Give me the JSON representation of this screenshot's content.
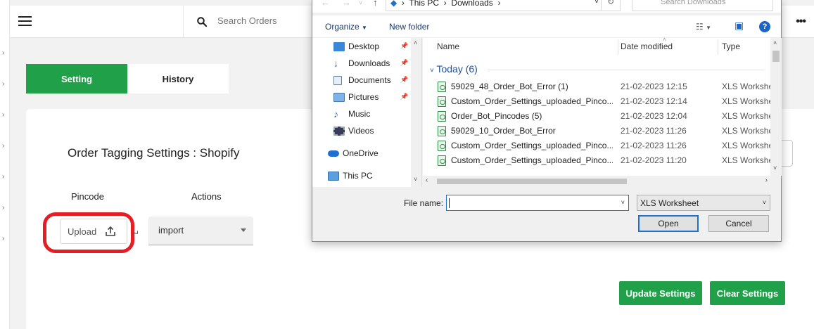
{
  "header": {
    "search_placeholder": "Search Orders"
  },
  "tabs": [
    {
      "label": "Setting",
      "active": true
    },
    {
      "label": "History",
      "active": false
    }
  ],
  "card": {
    "title": "Order Tagging Settings : Shopify",
    "col_pincode": "Pincode",
    "col_actions": "Actions",
    "upload_label": "Upload",
    "action_value": "import",
    "update_button": "Update Settings",
    "clear_button": "Clear Settings"
  },
  "colors": {
    "accent_green": "#21a04a",
    "highlight_red": "#e31e25",
    "dialog_blue": "#1e6fd0"
  },
  "dialog": {
    "breadcrumb": [
      "This PC",
      "Downloads"
    ],
    "search_placeholder": "Search Downloads",
    "organize_label": "Organize",
    "new_folder_label": "New folder",
    "nav_items": [
      {
        "label": "Desktop",
        "icon": "desktop-icon",
        "pinned": true
      },
      {
        "label": "Downloads",
        "icon": "download-arrow-icon",
        "pinned": true
      },
      {
        "label": "Documents",
        "icon": "document-icon",
        "pinned": true
      },
      {
        "label": "Pictures",
        "icon": "picture-icon",
        "pinned": true
      },
      {
        "label": "Music",
        "icon": "music-note-icon",
        "pinned": false
      },
      {
        "label": "Videos",
        "icon": "video-icon",
        "pinned": false
      },
      {
        "label": "OneDrive",
        "icon": "cloud-icon",
        "pinned": false
      },
      {
        "label": "This PC",
        "icon": "computer-icon",
        "pinned": false
      }
    ],
    "columns": {
      "name": "Name",
      "date": "Date modified",
      "type": "Type"
    },
    "group_label": "Today (6)",
    "files": [
      {
        "name": "59029_48_Order_Bot_Error (1)",
        "date": "21-02-2023 12:15",
        "type": "XLS Worksheet"
      },
      {
        "name": "Custom_Order_Settings_uploaded_Pinco...",
        "date": "21-02-2023 12:14",
        "type": "XLS Worksheet"
      },
      {
        "name": "Order_Bot_Pincodes (5)",
        "date": "21-02-2023 12:04",
        "type": "XLS Worksheet"
      },
      {
        "name": "59029_10_Order_Bot_Error",
        "date": "21-02-2023 11:26",
        "type": "XLS Worksheet"
      },
      {
        "name": "Custom_Order_Settings_uploaded_Pinco...",
        "date": "21-02-2023 11:26",
        "type": "XLS Worksheet"
      },
      {
        "name": "Custom_Order_Settings_uploaded_Pinco...",
        "date": "21-02-2023 11:20",
        "type": "XLS Worksheet"
      }
    ],
    "file_name_label": "File name:",
    "file_name_value": "",
    "file_type_value": "XLS Worksheet",
    "open_button": "Open",
    "cancel_button": "Cancel"
  }
}
